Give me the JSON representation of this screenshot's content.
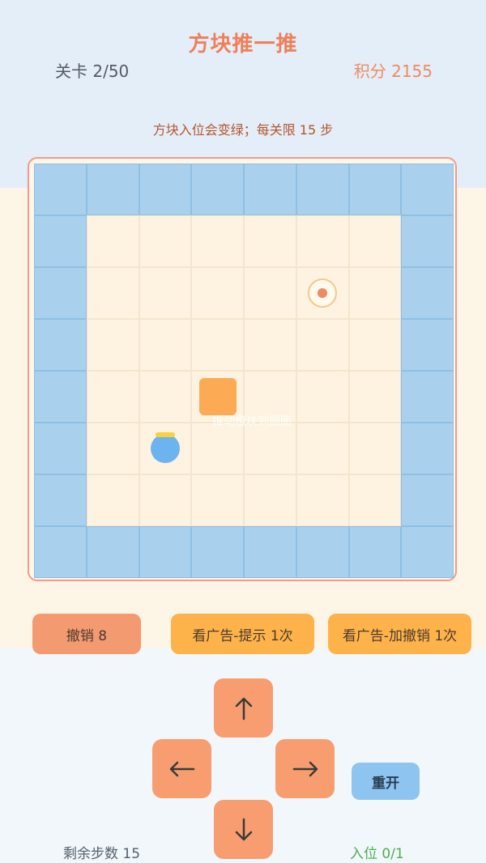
{
  "header": {
    "title": "方块推一推",
    "level": "关卡 2/50",
    "score": "积分 2155",
    "hint": "方块入位会变绿；每关限 15 步"
  },
  "board": {
    "cols": 8,
    "rows": 8,
    "ghost_text": "推动橙块到圆圈",
    "box_cell": [
      3,
      4
    ],
    "target_cell": [
      5,
      2
    ],
    "player_cell": [
      2,
      5
    ]
  },
  "actions": {
    "undo_label": "撤销 8",
    "ad_hint_label": "看广告-提示 1次",
    "ad_undo_label": "看广告-加撤销 1次",
    "restart_label": "重开"
  },
  "dpad": {
    "up_icon": "arrow-up-icon",
    "down_icon": "arrow-down-icon",
    "left_icon": "arrow-left-icon",
    "right_icon": "arrow-right-icon"
  },
  "status": {
    "steps_left": "剩余步数 15",
    "placed": "入位 0/1"
  },
  "colors": {
    "title": "#ef7f58",
    "wall": "#a9d1ed",
    "floor": "#fdf3e0",
    "box": "#fdaa55",
    "player": "#6cb4f0",
    "target_dot": "#f08a64",
    "placed_text": "#4caf50"
  }
}
